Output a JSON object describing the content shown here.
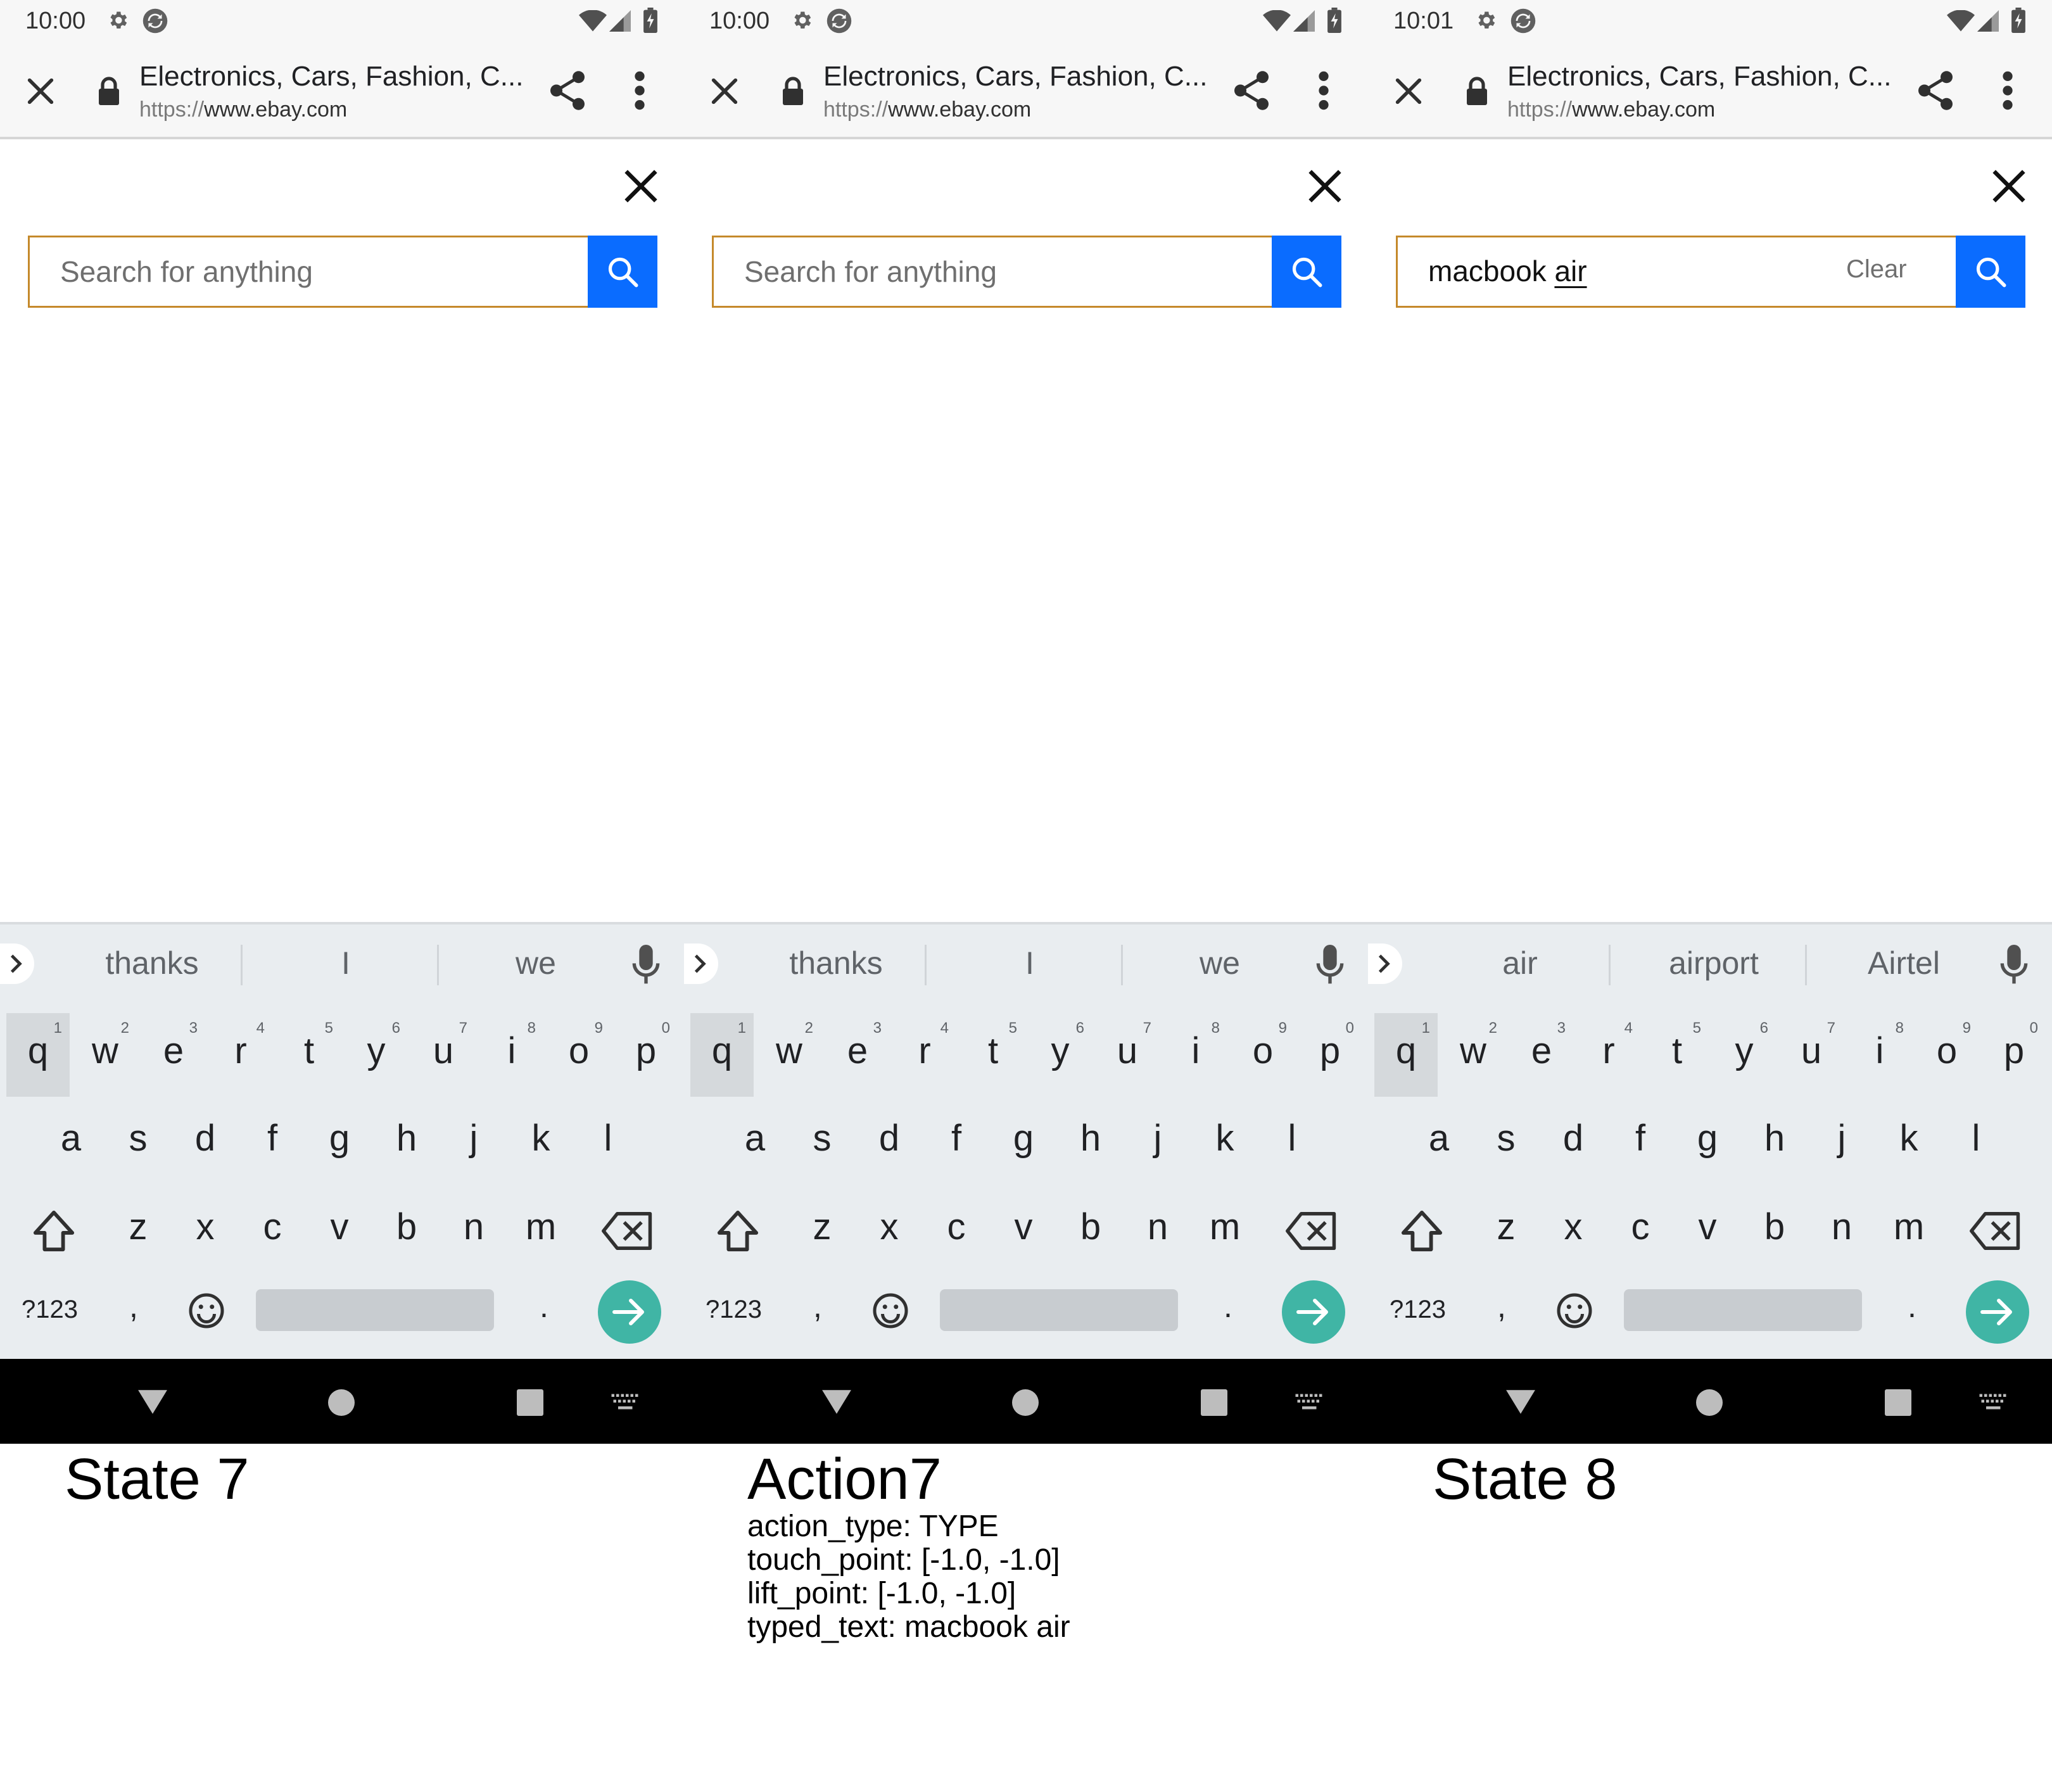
{
  "status_bar": {
    "wifi_icon": "wifi-icon",
    "signal_icon": "cell-signal-icon",
    "battery_icon": "battery-icon"
  },
  "toolbar": {
    "tab_title": "Electronics, Cars, Fashion, C...",
    "url_scheme": "https://",
    "url_host": "www.ebay.com"
  },
  "search": {
    "placeholder": "Search for anything",
    "clear_label": "Clear"
  },
  "screens": [
    {
      "time": "10:00",
      "search_value": "",
      "typed_prefix": "",
      "typed_composing": "",
      "suggestions": [
        "thanks",
        "I",
        "we"
      ]
    },
    {
      "time": "10:00",
      "search_value": "",
      "typed_prefix": "",
      "typed_composing": "",
      "suggestions": [
        "thanks",
        "I",
        "we"
      ]
    },
    {
      "time": "10:01",
      "search_value": "macbook air",
      "typed_prefix": "macbook ",
      "typed_composing": "air",
      "suggestions": [
        "air",
        "airport",
        "Airtel"
      ]
    }
  ],
  "keyboard": {
    "row1": [
      {
        "key": "q",
        "hint": "1"
      },
      {
        "key": "w",
        "hint": "2"
      },
      {
        "key": "e",
        "hint": "3"
      },
      {
        "key": "r",
        "hint": "4"
      },
      {
        "key": "t",
        "hint": "5"
      },
      {
        "key": "y",
        "hint": "6"
      },
      {
        "key": "u",
        "hint": "7"
      },
      {
        "key": "i",
        "hint": "8"
      },
      {
        "key": "o",
        "hint": "9"
      },
      {
        "key": "p",
        "hint": "0"
      }
    ],
    "row2": [
      "a",
      "s",
      "d",
      "f",
      "g",
      "h",
      "j",
      "k",
      "l"
    ],
    "row3": [
      "z",
      "x",
      "c",
      "v",
      "b",
      "n",
      "m"
    ],
    "symbols_label": "?123",
    "comma": ",",
    "period": "."
  },
  "captions": {
    "state_before": "State 7",
    "action_title": "Action7",
    "state_after": "State 8",
    "action_details": [
      "action_type: TYPE",
      "touch_point: [-1.0, -1.0]",
      "lift_point: [-1.0, -1.0]",
      "typed_text: macbook air"
    ]
  },
  "colors": {
    "search_button": "#0a6cff",
    "search_border": "#c5892b",
    "go_key": "#40b5a5",
    "keyboard_bg": "#e9edf0"
  }
}
